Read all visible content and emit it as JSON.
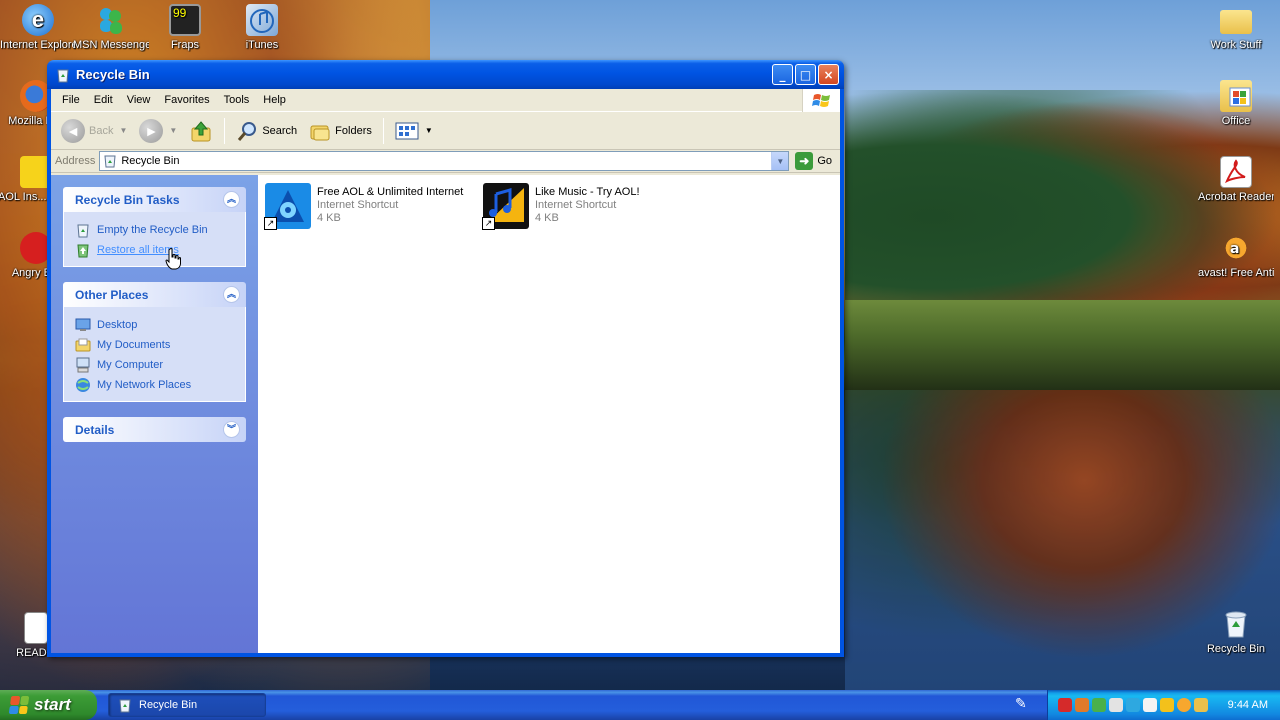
{
  "desktop": {
    "icons_left": [
      {
        "label": "Internet Explorer (B..."
      },
      {
        "label": "MSN Messenger 5.0"
      },
      {
        "label": "Fraps"
      },
      {
        "label": "iTunes"
      },
      {
        "label": "Mozilla Fi..."
      },
      {
        "label": "AOL Ins... Messen..."
      },
      {
        "label": "Angry B..."
      },
      {
        "label": "READ..."
      }
    ],
    "icons_right": [
      {
        "label": "Work Stuff"
      },
      {
        "label": "Office"
      },
      {
        "label": "Acrobat Reader 5.0"
      },
      {
        "label": "avast! Free Antivirus"
      },
      {
        "label": "Recycle Bin"
      }
    ]
  },
  "window": {
    "title": "Recycle Bin",
    "controls": {
      "minimize": "_",
      "maximize": "□",
      "close": "×"
    }
  },
  "menu": [
    "File",
    "Edit",
    "View",
    "Favorites",
    "Tools",
    "Help"
  ],
  "toolbar": {
    "back": "Back",
    "search": "Search",
    "folders": "Folders"
  },
  "address": {
    "label": "Address",
    "value": "Recycle Bin",
    "go": "Go"
  },
  "taskpane": {
    "tasks": {
      "title": "Recycle Bin Tasks",
      "items": [
        "Empty the Recycle Bin",
        "Restore all items"
      ]
    },
    "places": {
      "title": "Other Places",
      "items": [
        "Desktop",
        "My Documents",
        "My Computer",
        "My Network Places"
      ]
    },
    "details": {
      "title": "Details"
    }
  },
  "files": [
    {
      "name": "Free AOL & Unlimited Internet",
      "type": "Internet Shortcut",
      "size": "4 KB"
    },
    {
      "name": "Like Music - Try AOL!",
      "type": "Internet Shortcut",
      "size": "4 KB"
    }
  ],
  "taskbar": {
    "start": "start",
    "task": "Recycle Bin",
    "clock": "9:44 AM"
  },
  "colors": {
    "xp_blue": "#0054e3",
    "taskpane_link": "#215dc6",
    "start_green": "#3c9c36"
  }
}
